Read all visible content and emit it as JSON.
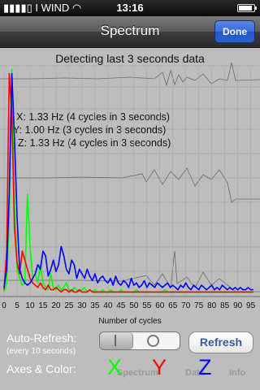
{
  "status_bar": {
    "carrier": "I WIND",
    "time": "13:16",
    "battery_level": 0.9
  },
  "nav": {
    "title": "Spectrum",
    "done_label": "Done"
  },
  "info": {
    "detect_text": "Detecting last 3 seconds data",
    "x_line": "X: 1.33 Hz (4 cycles in 3 seconds)",
    "y_line": "Y: 1.00 Hz (3 cycles in 3 seconds)",
    "z_line": "Z: 1.33 Hz (4 cycles in 3 seconds)"
  },
  "controls": {
    "auto_refresh_label": "Auto-Refresh:",
    "auto_refresh_sub": "(every 10 seconds)",
    "auto_refresh_on": false,
    "refresh_label": "Refresh",
    "axes_color_label": "Axes & Color:",
    "axes": [
      {
        "letter": "X",
        "color": "#00ff00"
      },
      {
        "letter": "Y",
        "color": "#ff0000"
      },
      {
        "letter": "Z",
        "color": "#0000ff"
      }
    ]
  },
  "background_tabs": [
    "Spectrum",
    "Data",
    "Info"
  ],
  "chart_data": {
    "type": "line",
    "xlabel": "Number of cycles",
    "ylabel": "",
    "xlim": [
      0,
      97
    ],
    "x_ticks": [
      0,
      5,
      10,
      15,
      20,
      25,
      30,
      35,
      40,
      45,
      50,
      55,
      60,
      65,
      70,
      75,
      80,
      85,
      90,
      95
    ],
    "ylim": [
      0,
      100
    ],
    "colors": {
      "X": "#00ff00",
      "Y": "#ff0000",
      "Z": "#0000ff"
    },
    "series": [
      {
        "name": "X",
        "values": [
          2,
          6,
          35,
          100,
          40,
          12,
          8,
          5,
          6,
          45,
          22,
          8,
          10,
          6,
          14,
          6,
          4,
          3,
          10,
          4,
          3,
          5,
          3,
          4,
          6,
          3,
          2,
          4,
          3,
          2,
          3,
          4,
          2,
          3,
          2,
          3,
          2,
          2,
          3,
          2,
          2,
          3,
          2,
          2,
          2,
          3,
          2,
          2,
          2,
          2,
          2,
          3,
          2,
          2,
          2,
          2,
          2,
          2,
          2,
          2,
          2,
          2,
          3,
          2,
          2,
          2,
          2,
          2,
          2,
          2,
          2,
          2,
          2,
          2,
          2,
          2,
          2,
          2,
          2,
          2,
          2,
          2,
          2,
          2,
          2,
          2,
          2,
          2,
          2,
          2,
          2,
          2,
          2,
          2,
          2,
          2,
          2
        ]
      },
      {
        "name": "Y",
        "values": [
          3,
          20,
          98,
          80,
          30,
          15,
          10,
          20,
          16,
          12,
          8,
          6,
          5,
          4,
          6,
          4,
          3,
          5,
          3,
          3,
          4,
          3,
          2,
          3,
          3,
          2,
          3,
          2,
          2,
          3,
          2,
          2,
          2,
          3,
          2,
          2,
          2,
          2,
          2,
          2,
          2,
          2,
          2,
          2,
          2,
          2,
          2,
          2,
          2,
          2,
          2,
          2,
          2,
          2,
          2,
          2,
          2,
          2,
          2,
          2,
          2,
          2,
          2,
          2,
          2,
          2,
          2,
          2,
          2,
          2,
          2,
          2,
          2,
          2,
          2,
          2,
          2,
          2,
          2,
          2,
          2,
          2,
          2,
          2,
          2,
          2,
          2,
          2,
          2,
          2,
          2,
          2,
          2,
          2,
          2,
          2,
          2
        ]
      },
      {
        "name": "Z",
        "values": [
          4,
          12,
          45,
          98,
          70,
          35,
          12,
          8,
          6,
          5,
          6,
          8,
          10,
          14,
          12,
          20,
          18,
          9,
          12,
          16,
          11,
          14,
          22,
          18,
          12,
          10,
          16,
          14,
          8,
          12,
          10,
          8,
          12,
          9,
          7,
          10,
          6,
          8,
          9,
          7,
          6,
          8,
          5,
          9,
          6,
          5,
          7,
          6,
          4,
          8,
          5,
          6,
          4,
          5,
          7,
          4,
          6,
          5,
          4,
          6,
          5,
          4,
          5,
          6,
          4,
          5,
          4,
          3,
          5,
          4,
          6,
          4,
          3,
          5,
          4,
          3,
          5,
          4,
          3,
          4,
          5,
          3,
          4,
          3,
          5,
          4,
          3,
          4,
          3,
          4,
          3,
          4,
          3,
          3,
          4,
          3,
          3
        ]
      }
    ]
  }
}
